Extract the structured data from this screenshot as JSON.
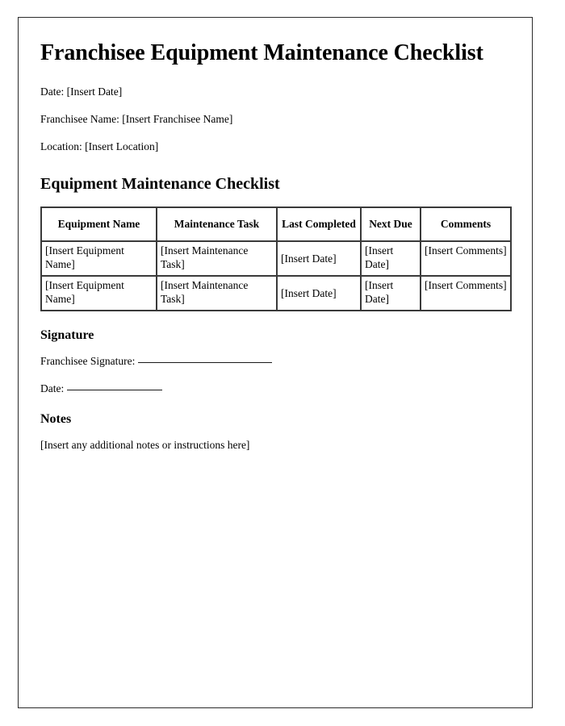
{
  "document": {
    "title": "Franchisee Equipment Maintenance Checklist",
    "meta": {
      "date_line": "Date: [Insert Date]",
      "franchisee_line": "Franchisee Name: [Insert Franchisee Name]",
      "location_line": "Location: [Insert Location]"
    },
    "checklist_section": {
      "heading": "Equipment Maintenance Checklist",
      "table": {
        "columns": [
          "Equipment Name",
          "Maintenance Task",
          "Last Completed",
          "Next Due",
          "Comments"
        ],
        "rows": [
          [
            "[Insert Equipment Name]",
            "[Insert Maintenance Task]",
            "[Insert Date]",
            "[Insert Date]",
            "[Insert Comments]"
          ],
          [
            "[Insert Equipment Name]",
            "[Insert Maintenance Task]",
            "[Insert Date]",
            "[Insert Date]",
            "[Insert Comments]"
          ]
        ]
      }
    },
    "signature_section": {
      "heading": "Signature",
      "signature_label": "Franchisee Signature:",
      "date_label": "Date:"
    },
    "notes_section": {
      "heading": "Notes",
      "placeholder": "[Insert any additional notes or instructions here]"
    }
  }
}
